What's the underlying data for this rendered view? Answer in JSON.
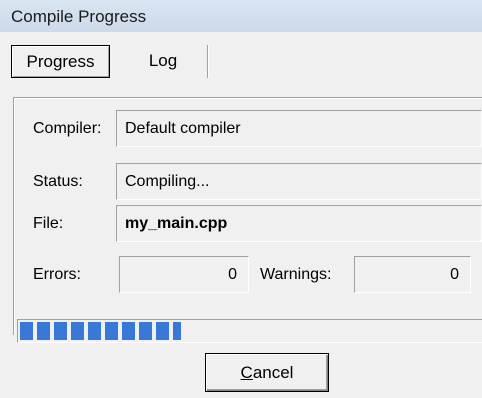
{
  "window": {
    "title": "Compile Progress"
  },
  "tabs": [
    {
      "label": "Progress",
      "active": true
    },
    {
      "label": "Log",
      "active": false
    }
  ],
  "fields": {
    "compiler": {
      "label": "Compiler:",
      "value": "Default compiler"
    },
    "status": {
      "label": "Status:",
      "value": "Compiling..."
    },
    "file": {
      "label": "File:",
      "value": "my_main.cpp"
    },
    "errors": {
      "label": "Errors:",
      "value": "0"
    },
    "warnings": {
      "label": "Warnings:",
      "value": "0"
    }
  },
  "progress": {
    "fraction": 0.35
  },
  "cancel_button": {
    "mnemonic": "C",
    "rest": "ancel"
  },
  "colors": {
    "progress": "#3a78d8",
    "titlebar": "#cdd9ea",
    "background": "#f0f0f0"
  }
}
